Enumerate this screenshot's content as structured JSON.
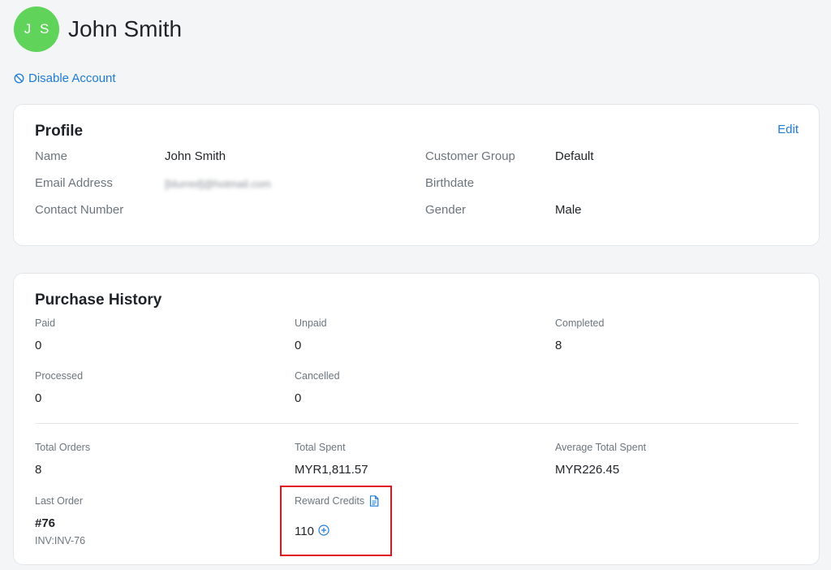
{
  "header": {
    "avatar_initials": "J S",
    "avatar_color": "#5fd35a",
    "customer_name": "John Smith"
  },
  "actions": {
    "disable_account": "Disable Account"
  },
  "profile": {
    "title": "Profile",
    "edit_label": "Edit",
    "fields": {
      "name_label": "Name",
      "name_value": "John Smith",
      "email_label": "Email Address",
      "email_value": "[blurred]@hotmail.com",
      "contact_label": "Contact Number",
      "contact_value": "",
      "group_label": "Customer Group",
      "group_value": "Default",
      "birthdate_label": "Birthdate",
      "birthdate_value": "",
      "gender_label": "Gender",
      "gender_value": "Male"
    }
  },
  "purchase_history": {
    "title": "Purchase History",
    "paid_label": "Paid",
    "paid_value": "0",
    "unpaid_label": "Unpaid",
    "unpaid_value": "0",
    "completed_label": "Completed",
    "completed_value": "8",
    "processed_label": "Processed",
    "processed_value": "0",
    "cancelled_label": "Cancelled",
    "cancelled_value": "0",
    "total_orders_label": "Total Orders",
    "total_orders_value": "8",
    "total_spent_label": "Total Spent",
    "total_spent_value": "MYR1,811.57",
    "avg_spent_label": "Average Total Spent",
    "avg_spent_value": "MYR226.45",
    "last_order_label": "Last Order",
    "last_order_value": "#76",
    "last_order_invoice": "INV:INV-76",
    "reward_credits_label": "Reward Credits",
    "reward_credits_value": "110"
  },
  "colors": {
    "accent": "#1f7bd6",
    "highlight": "#e3131b"
  },
  "icons": {
    "disable": "ban-icon",
    "reward_doc": "document-icon",
    "add_credit": "plus-circle-icon"
  }
}
